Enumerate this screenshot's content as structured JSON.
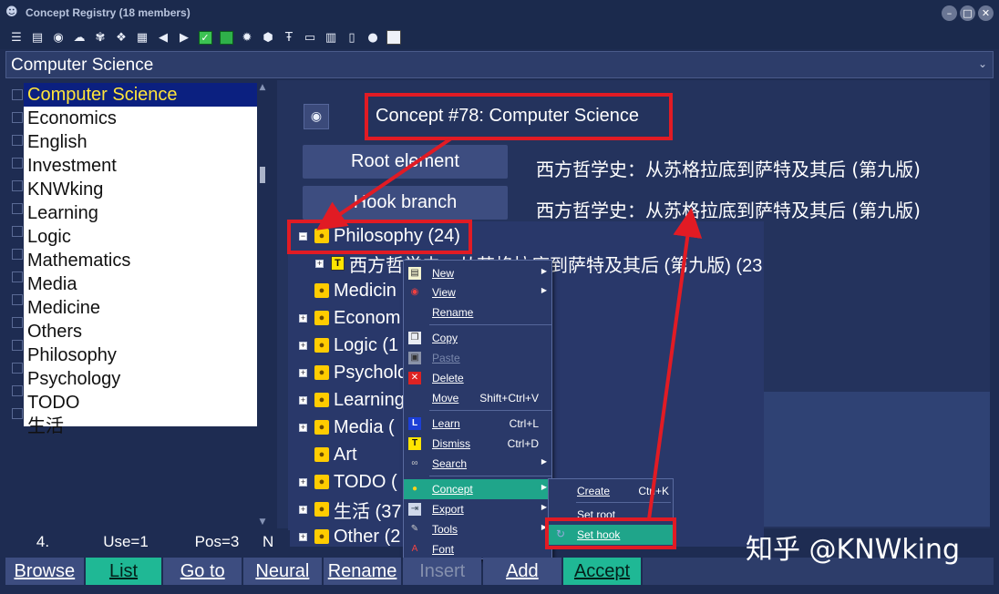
{
  "window": {
    "title": "Concept Registry (18 members)",
    "buttons": [
      "–",
      "□",
      "✕"
    ]
  },
  "toolbar": {
    "icons": [
      "list-icon",
      "list2-icon",
      "globe-icon",
      "cloud-icon",
      "brain-icon",
      "network-icon",
      "data-icon",
      "left-arrow-icon",
      "right-arrow-icon",
      "checkbox-icon",
      "green-square-icon",
      "brain2-icon",
      "cube-icon",
      "text-icon",
      "doc-icon",
      "doc2-icon",
      "page-icon",
      "cloud2-icon",
      "blank-icon"
    ]
  },
  "combo": {
    "value": "Computer Science"
  },
  "sidebar": {
    "items": [
      {
        "label": "Computer Science",
        "selected": true
      },
      {
        "label": "Economics"
      },
      {
        "label": "English"
      },
      {
        "label": "Investment"
      },
      {
        "label": "KNWking"
      },
      {
        "label": "Learning"
      },
      {
        "label": "Logic"
      },
      {
        "label": "Mathematics"
      },
      {
        "label": "Media"
      },
      {
        "label": "Medicine"
      },
      {
        "label": "Others"
      },
      {
        "label": "Philosophy"
      },
      {
        "label": "Psychology"
      },
      {
        "label": "TODO"
      },
      {
        "label": "生活"
      }
    ]
  },
  "main": {
    "concept_title": "Concept #78: Computer Science",
    "root_button": "Root element",
    "hook_button": "Hook branch",
    "root_text": "西方哲学史：从苏格拉底到萨特及其后 (第九版)",
    "hook_text": "西方哲学史：从苏格拉底到萨特及其后 (第九版)"
  },
  "tree": {
    "rows": [
      {
        "label": "Philosophy (24)",
        "type": "bulb",
        "expander": "−"
      },
      {
        "label": "西方哲学史：从苏格拉底到萨特及其后 (第九版) (23",
        "type": "T",
        "expander": "+"
      },
      {
        "label": "Medicin",
        "type": "bulb",
        "expander": ""
      },
      {
        "label": "Econom",
        "type": "bulb",
        "expander": "+"
      },
      {
        "label": "Logic (1",
        "type": "bulb",
        "expander": "+"
      },
      {
        "label": "Psycholo",
        "type": "bulb",
        "expander": "+"
      },
      {
        "label": "Learning",
        "type": "bulb",
        "expander": "+"
      },
      {
        "label": "Media (",
        "type": "bulb",
        "expander": "+"
      },
      {
        "label": "Art",
        "type": "bulb",
        "expander": ""
      },
      {
        "label": "TODO (",
        "type": "bulb",
        "expander": "+"
      },
      {
        "label": "生活 (37",
        "type": "bulb",
        "expander": "+"
      },
      {
        "label": "Other (2",
        "type": "bulb",
        "expander": "+"
      }
    ]
  },
  "context_menu": {
    "items": [
      {
        "label": "New",
        "icon": "new-icon",
        "submenu": true
      },
      {
        "label": "View",
        "icon": "eye-icon",
        "submenu": true
      },
      {
        "label": "Rename",
        "icon": ""
      },
      {
        "label": "Copy",
        "icon": "copy-icon"
      },
      {
        "label": "Paste",
        "icon": "paste-icon",
        "disabled": true
      },
      {
        "label": "Delete",
        "icon": "delete-icon"
      },
      {
        "label": "Move",
        "icon": "",
        "shortcut": "Shift+Ctrl+V"
      },
      {
        "label": "Learn",
        "icon": "learn-icon",
        "shortcut": "Ctrl+L"
      },
      {
        "label": "Dismiss",
        "icon": "dismiss-icon",
        "shortcut": "Ctrl+D"
      },
      {
        "label": "Search",
        "icon": "binoculars-icon",
        "submenu": true
      },
      {
        "label": "Concept",
        "icon": "bulb-icon",
        "submenu": true,
        "highlighted": true
      },
      {
        "label": "Export",
        "icon": "export-icon",
        "submenu": true
      },
      {
        "label": "Tools",
        "icon": "wrench-icon",
        "submenu": true
      },
      {
        "label": "Font",
        "icon": "font-icon"
      }
    ]
  },
  "concept_submenu": {
    "items": [
      {
        "label": "Create",
        "shortcut": "Ctrl+K"
      },
      {
        "label": "Set root"
      },
      {
        "label": "Set hook",
        "highlighted": true
      }
    ]
  },
  "status": {
    "index": "4.",
    "use": "Use=1",
    "pos": "Pos=3",
    "extra": "N"
  },
  "buttons": {
    "browse": "Browse",
    "list": "List",
    "goto": "Go to",
    "neural": "Neural",
    "rename": "Rename",
    "insert": "Insert",
    "add": "Add",
    "accept": "Accept"
  },
  "watermark": "知乎 @KNWking",
  "colors": {
    "accent": "#1fb895",
    "annotation_red": "#e11b24",
    "selection_blue": "#0b2080"
  }
}
